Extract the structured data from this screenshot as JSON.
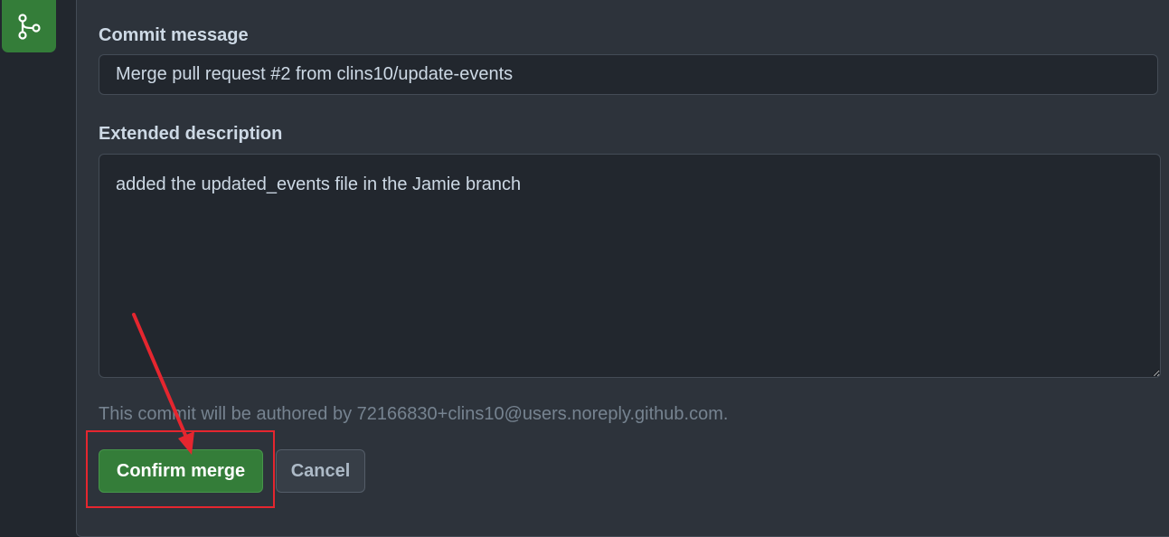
{
  "form": {
    "commit_message_label": "Commit message",
    "commit_message_value": "Merge pull request #2 from clins10/update-events",
    "extended_description_label": "Extended description",
    "extended_description_value": "added the updated_events file in the Jamie branch",
    "author_note": "This commit will be authored by 72166830+clins10@users.noreply.github.com."
  },
  "actions": {
    "confirm_label": "Confirm merge",
    "cancel_label": "Cancel"
  },
  "icons": {
    "merge": "git-merge-icon"
  },
  "colors": {
    "primary_button": "#347d39",
    "annotation": "#e5262f",
    "background": "#2d333b"
  }
}
